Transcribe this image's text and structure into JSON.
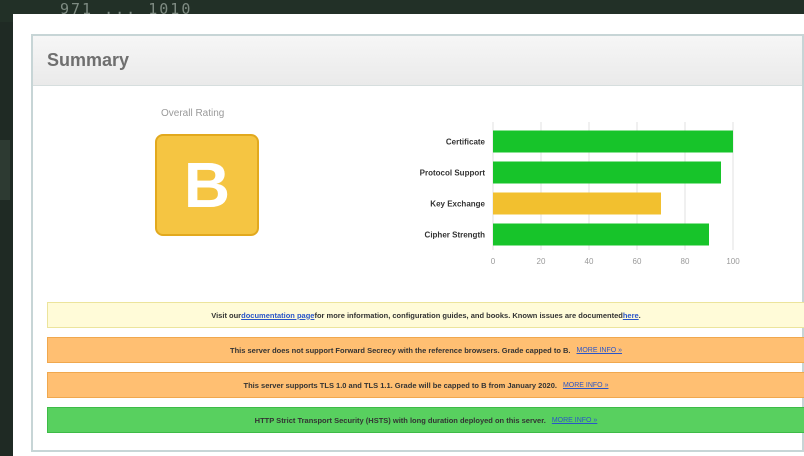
{
  "background": {
    "text": "971 ... 1010"
  },
  "summary": {
    "title": "Summary",
    "overall_rating_label": "Overall Rating",
    "grade": "B",
    "grade_color": "#f5c542"
  },
  "chart_data": {
    "type": "bar",
    "orientation": "horizontal",
    "categories": [
      "Certificate",
      "Protocol Support",
      "Key Exchange",
      "Cipher Strength"
    ],
    "values": [
      100,
      95,
      70,
      90
    ],
    "colors": [
      "#17c42a",
      "#17c42a",
      "#f2c02f",
      "#17c42a"
    ],
    "xlim": [
      0,
      100
    ],
    "xticks": [
      "0",
      "20",
      "40",
      "60",
      "80",
      "100"
    ],
    "grid": true
  },
  "messages": {
    "info": {
      "prefix": "Visit our ",
      "link_text": "documentation page",
      "middle": " for more information, configuration guides, and books. Known issues are documented ",
      "link2_text": "here",
      "suffix": "."
    },
    "warn1": {
      "text": "This server does not support Forward Secrecy with the reference browsers. Grade capped to B.",
      "more": "MORE INFO »"
    },
    "warn2": {
      "text": "This server supports TLS 1.0 and TLS 1.1. Grade will be capped to B from January 2020.",
      "more": "MORE INFO »"
    },
    "good": {
      "text": "HTTP Strict Transport Security (HSTS) with long duration deployed on this server.",
      "more": "MORE INFO »"
    }
  }
}
